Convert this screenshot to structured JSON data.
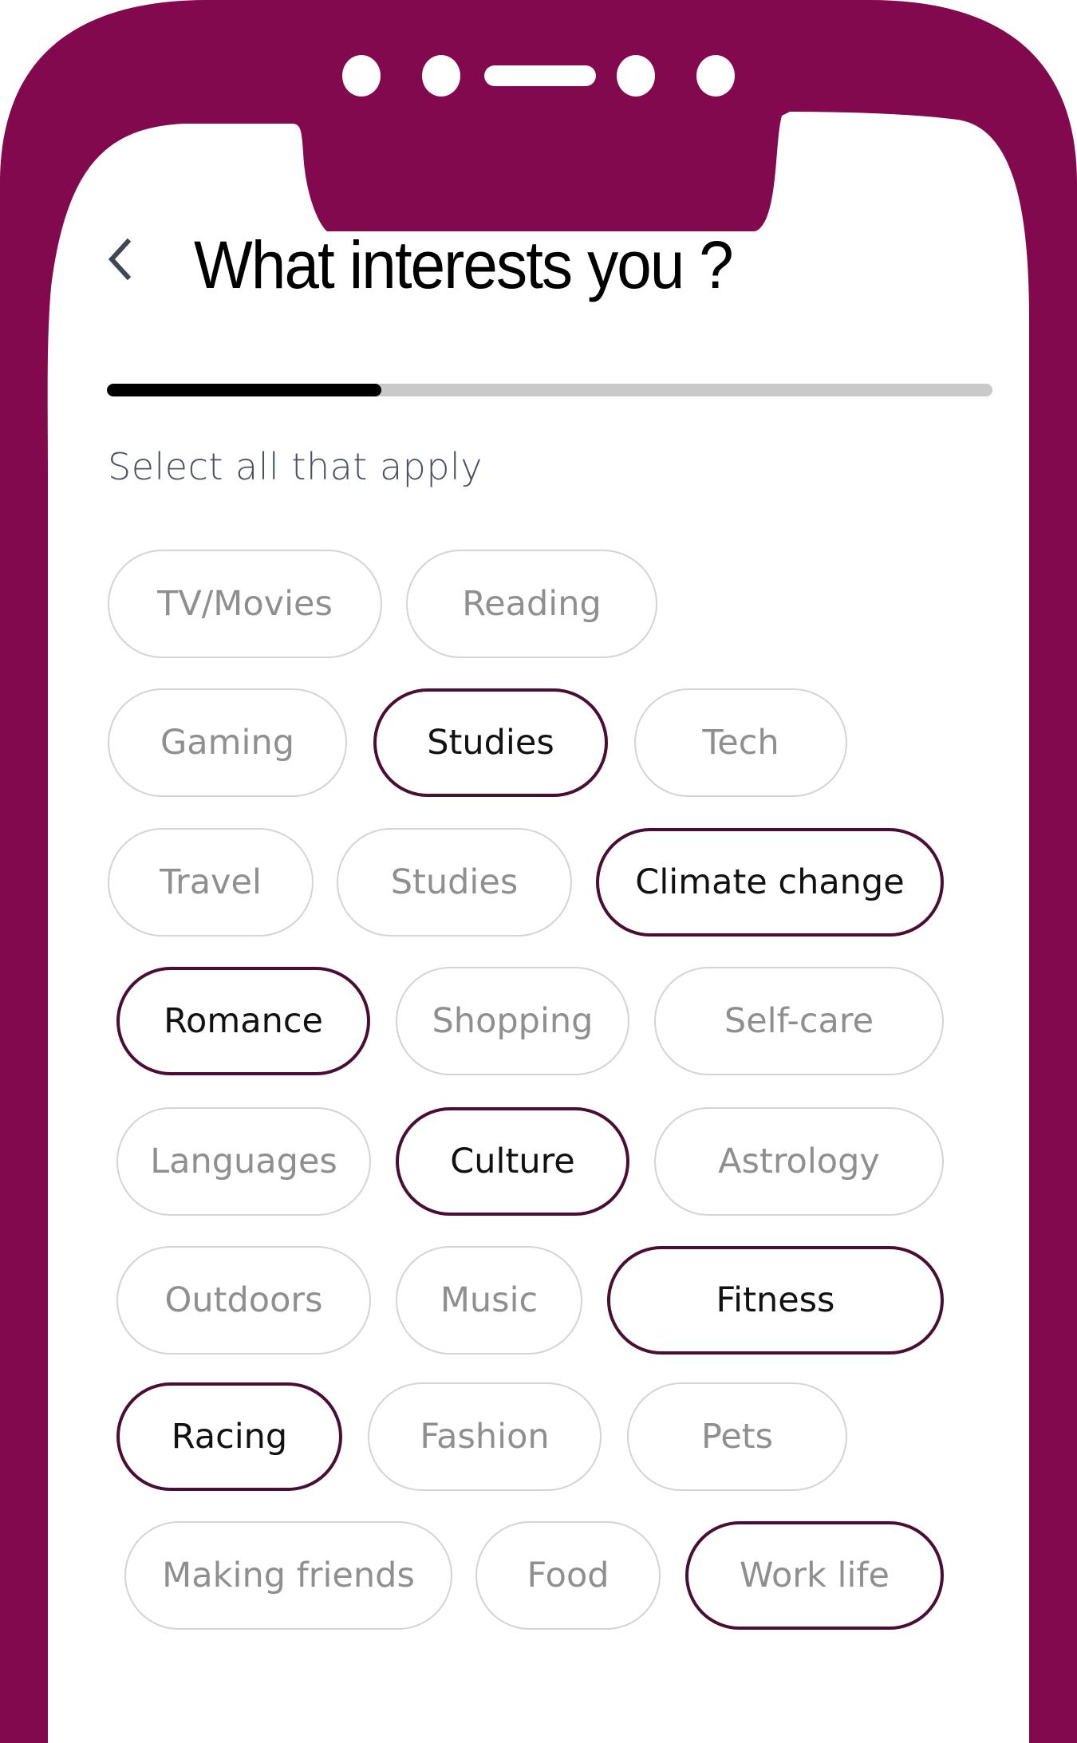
{
  "colors": {
    "frame": "#83094e",
    "selected_border": "#4a0e34",
    "unselected_border": "#d4d4d4",
    "progress_fill": "#000000",
    "progress_track": "#c9c9c9"
  },
  "header": {
    "back_icon": "chevron-left-icon",
    "title": "What interests you ?"
  },
  "progress": {
    "fraction": 0.31
  },
  "subtitle": "Select all that apply",
  "chips": [
    {
      "label": "TV/Movies",
      "selected": false
    },
    {
      "label": "Reading",
      "selected": false
    },
    {
      "label": "Gaming",
      "selected": false
    },
    {
      "label": "Studies",
      "selected": true
    },
    {
      "label": "Tech",
      "selected": false
    },
    {
      "label": "Travel",
      "selected": false
    },
    {
      "label": "Studies",
      "selected": false
    },
    {
      "label": "Climate change",
      "selected": true
    },
    {
      "label": "Romance",
      "selected": true
    },
    {
      "label": "Shopping",
      "selected": false
    },
    {
      "label": "Self-care",
      "selected": false
    },
    {
      "label": "Languages",
      "selected": false
    },
    {
      "label": "Culture",
      "selected": true
    },
    {
      "label": "Astrology",
      "selected": false
    },
    {
      "label": "Outdoors",
      "selected": false
    },
    {
      "label": "Music",
      "selected": false
    },
    {
      "label": "Fitness",
      "selected": true
    },
    {
      "label": "Racing",
      "selected": true
    },
    {
      "label": "Fashion",
      "selected": false
    },
    {
      "label": "Pets",
      "selected": false
    },
    {
      "label": "Making friends",
      "selected": false
    },
    {
      "label": "Food",
      "selected": false
    },
    {
      "label": "Work life",
      "selected": true
    }
  ]
}
